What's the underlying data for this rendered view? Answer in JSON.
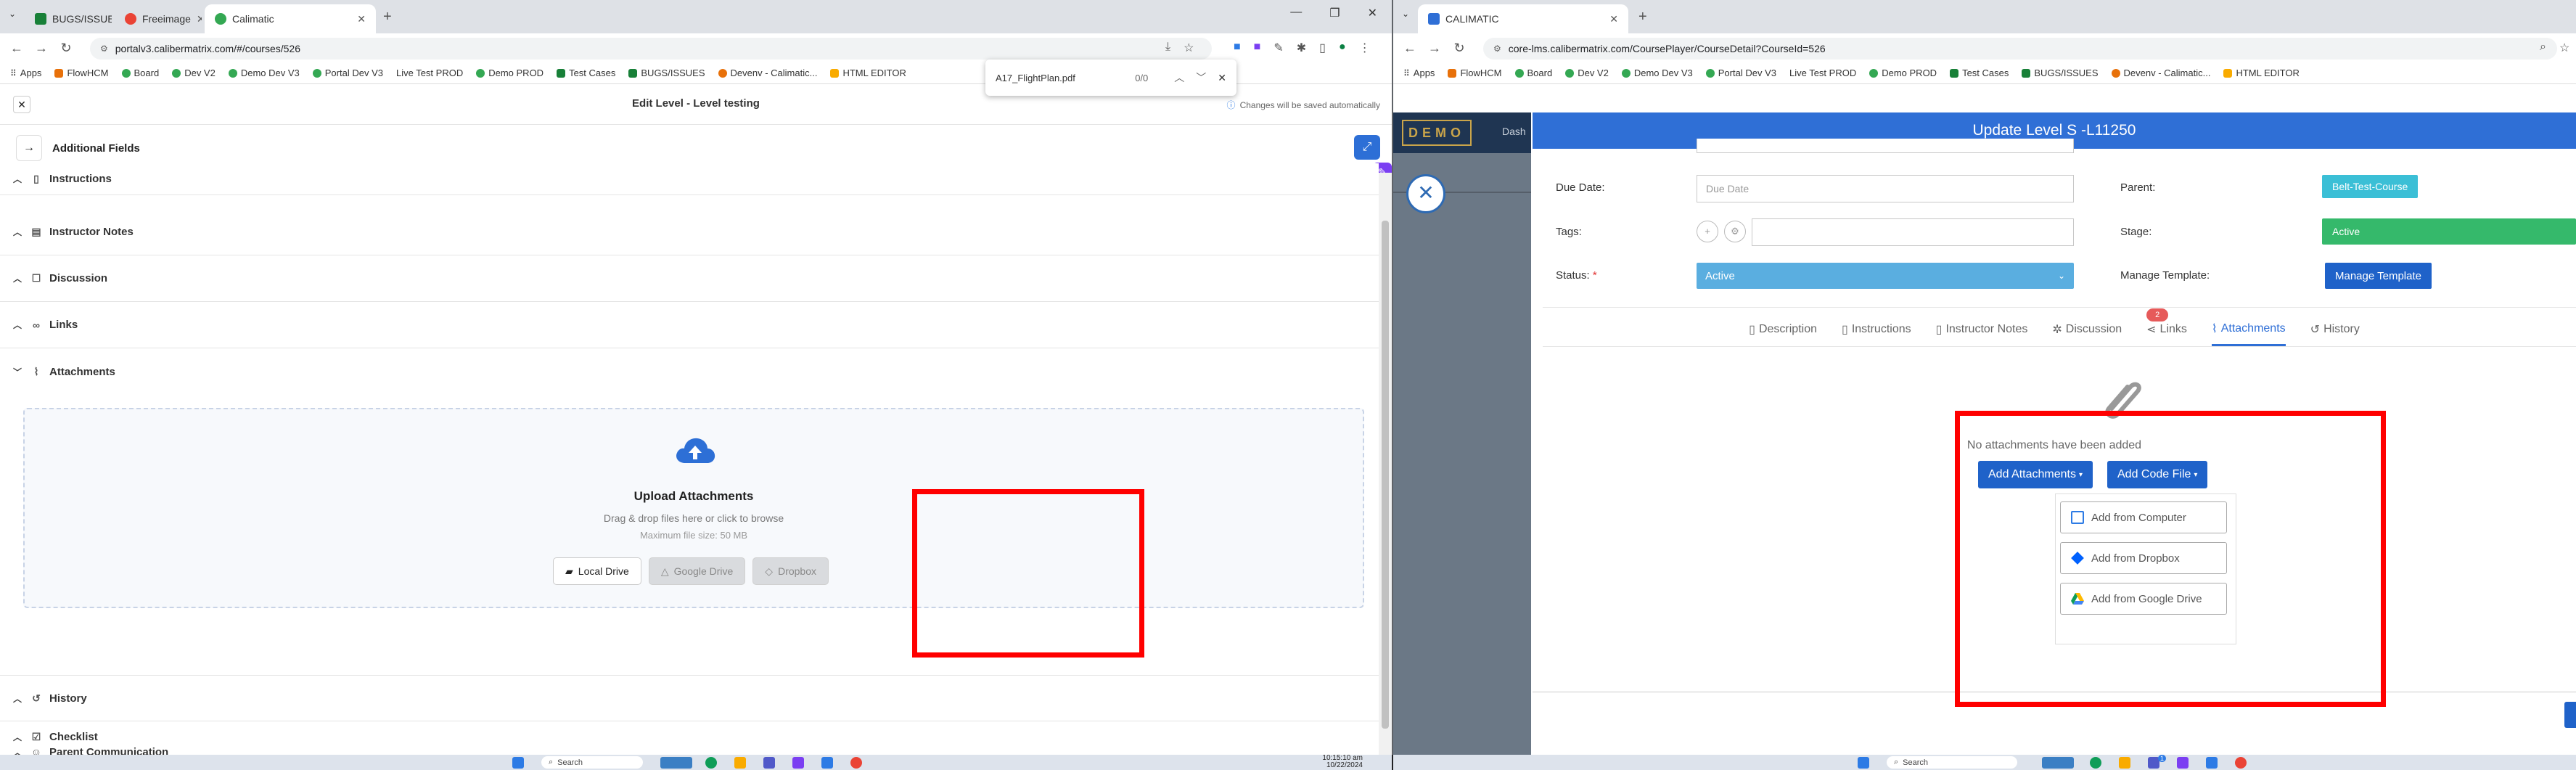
{
  "left_window": {
    "tabs": [
      {
        "label": "BUGS/ISSUES",
        "color": "#188038"
      },
      {
        "label": "Freeimage",
        "color": "#ea4335"
      },
      {
        "label": "Calimatic",
        "color": "#34a853"
      }
    ],
    "url": "portalv3.calibermatrix.com/#/courses/526",
    "bookmarks": [
      "Apps",
      "FlowHCM",
      "Board",
      "Dev V2",
      "Demo Dev V3",
      "Portal Dev V3",
      "Live Test PROD",
      "Demo PROD",
      "Test Cases",
      "BUGS/ISSUES",
      "Devenv - Calimatic...",
      "HTML EDITOR"
    ],
    "find_bar": {
      "query": "A17_FlightPlan.pdf",
      "count": "0/0"
    },
    "page": {
      "title": "Edit Level - Level testing",
      "saved_note": "Changes will be saved automatically",
      "additional_fields": "Additional Fields",
      "sections_top": [
        "Instructions",
        "Instructor Notes",
        "Discussion",
        "Links",
        "Attachments"
      ],
      "upload": {
        "title": "Upload Attachments",
        "subtitle": "Drag & drop files here or click to browse",
        "max_size": "Maximum file size: 50 MB",
        "buttons": [
          "Local Drive",
          "Google Drive",
          "Dropbox"
        ]
      },
      "sections_bottom": [
        "History",
        "Checklist",
        "Parent Communication"
      ]
    },
    "taskbar": {
      "search": "Search",
      "time": "10:15:10 am",
      "date": "10/22/2024"
    }
  },
  "right_window": {
    "tab_label": "CALIMATIC",
    "url": "core-lms.calibermatrix.com/CoursePlayer/CourseDetail?CourseId=526",
    "bookmarks": [
      "Apps",
      "FlowHCM",
      "Board",
      "Dev V2",
      "Demo Dev V3",
      "Portal Dev V3",
      "Live Test PROD",
      "Demo PROD",
      "Test Cases",
      "BUGS/ISSUES",
      "Devenv - Calimatic...",
      "HTML EDITOR"
    ],
    "logo_text": "DEMO",
    "nav_dash": "Dash",
    "modal": {
      "title": "Update Level S -L11250",
      "due_date_label": "Due Date:",
      "due_date_placeholder": "Due Date",
      "tags_label": "Tags:",
      "status_label": "Status:",
      "status_value": "Active",
      "parent_label": "Parent:",
      "parent_value": "Belt-Test-Course",
      "stage_label": "Stage:",
      "stage_value": "Active",
      "manage_template_label": "Manage Template:",
      "manage_template_button": "Manage Template",
      "tabs": [
        "Description",
        "Instructions",
        "Instructor Notes",
        "Discussion",
        "Links",
        "Attachments",
        "History"
      ],
      "links_badge": "2",
      "no_attachments": "No attachments have been added",
      "add_attachments": "Add Attachments",
      "add_code_file": "Add Code File",
      "menu": [
        "Add from Computer",
        "Add from Dropbox",
        "Add from Google Drive"
      ]
    },
    "taskbar": {
      "search": "Search",
      "notification_count": "1"
    }
  },
  "colors": {
    "accent_blue": "#2f6fd6",
    "status_blue": "#5aaee0",
    "parent_teal": "#3bbfd6",
    "stage_green": "#35b96b",
    "highlight_red": "#ff0000"
  }
}
